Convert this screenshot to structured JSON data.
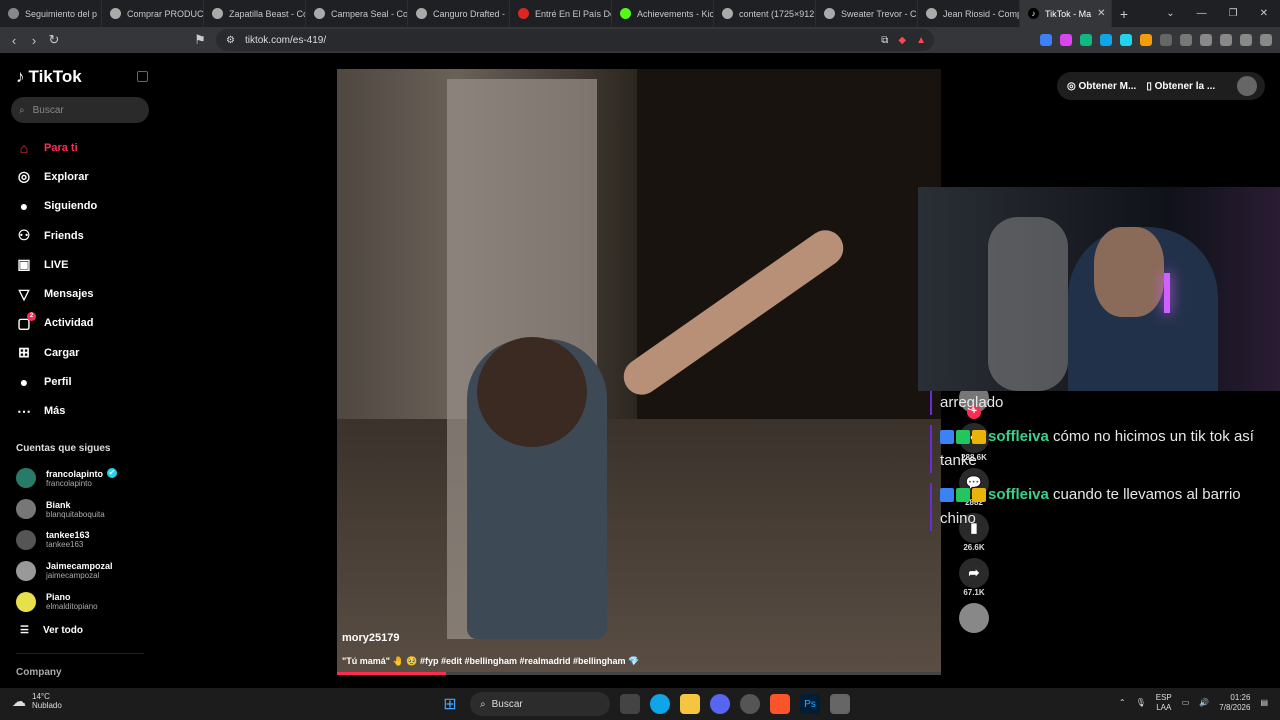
{
  "browser": {
    "tabs": [
      {
        "label": "Seguimiento del p",
        "color": "#888"
      },
      {
        "label": "Comprar PRODUCT",
        "color": "#aaa"
      },
      {
        "label": "Zapatilla Beast - Co",
        "color": "#aaa"
      },
      {
        "label": "Campera Seal - Co",
        "color": "#aaa"
      },
      {
        "label": "Canguro Drafted -",
        "color": "#aaa"
      },
      {
        "label": "Entré En El País Do",
        "color": "#e02424"
      },
      {
        "label": "Achievements - Kic",
        "color": "#53fc18"
      },
      {
        "label": "content (1725×912",
        "color": "#aaa"
      },
      {
        "label": "Sweater Trevor - C",
        "color": "#aaa"
      },
      {
        "label": "Jean Riosid - Comp",
        "color": "#aaa"
      }
    ],
    "active_tab": "TikTok - Ma",
    "url": "tiktok.com/es-419/"
  },
  "sidebar": {
    "logo": "TikTok",
    "search_placeholder": "Buscar",
    "nav": [
      {
        "label": "Para ti",
        "icon": "home-icon",
        "glyph": "⌂"
      },
      {
        "label": "Explorar",
        "icon": "compass-icon",
        "glyph": "◎"
      },
      {
        "label": "Siguiendo",
        "icon": "following-avatar-icon",
        "glyph": "●"
      },
      {
        "label": "Friends",
        "icon": "friends-icon",
        "glyph": "⚇"
      },
      {
        "label": "LIVE",
        "icon": "live-icon",
        "glyph": "▣"
      },
      {
        "label": "Mensajes",
        "icon": "messages-icon",
        "glyph": "▽"
      },
      {
        "label": "Actividad",
        "icon": "activity-icon",
        "glyph": "▢",
        "badge": "2"
      },
      {
        "label": "Cargar",
        "icon": "upload-icon",
        "glyph": "⊞"
      },
      {
        "label": "Perfil",
        "icon": "profile-icon",
        "glyph": "●"
      },
      {
        "label": "Más",
        "icon": "more-icon",
        "glyph": "⋯"
      }
    ],
    "following_title": "Cuentas que sigues",
    "following": [
      {
        "name": "francolapinto",
        "handle": "francolapinto",
        "verified": true
      },
      {
        "name": "Biank",
        "handle": "blanquitaboquita"
      },
      {
        "name": "tankee163",
        "handle": "tankee163"
      },
      {
        "name": "Jaimecampozal",
        "handle": "jaimecampozal"
      },
      {
        "name": "Piano",
        "handle": "elmalditopiano"
      }
    ],
    "see_all": "Ver todo",
    "company": "Company"
  },
  "video": {
    "author": "mory25179",
    "caption": "\"Tú mamá\" 🤚 🥹 #fyp #edit #bellingham #realmadrid #bellingham 💎",
    "progress": 0.18
  },
  "actions": {
    "likes": "288.6K",
    "comments": "2882",
    "saves": "26.6K",
    "shares": "67.1K"
  },
  "topright": {
    "get_coins": "Obtener M...",
    "get_app": "Obtener la ..."
  },
  "chat": [
    {
      "user": "",
      "text": "arreglado"
    },
    {
      "user": "soffleiva",
      "text": "cómo no hicimos un tik tok así tanke"
    },
    {
      "user": "soffleiva",
      "text": "cuando te llevamos al barrio chino"
    }
  ],
  "taskbar": {
    "temp": "14°C",
    "weather": "Nublado",
    "search": "Buscar",
    "lang1": "ESP",
    "lang2": "LAA",
    "time": "01:26",
    "date": "7/8/2026"
  }
}
